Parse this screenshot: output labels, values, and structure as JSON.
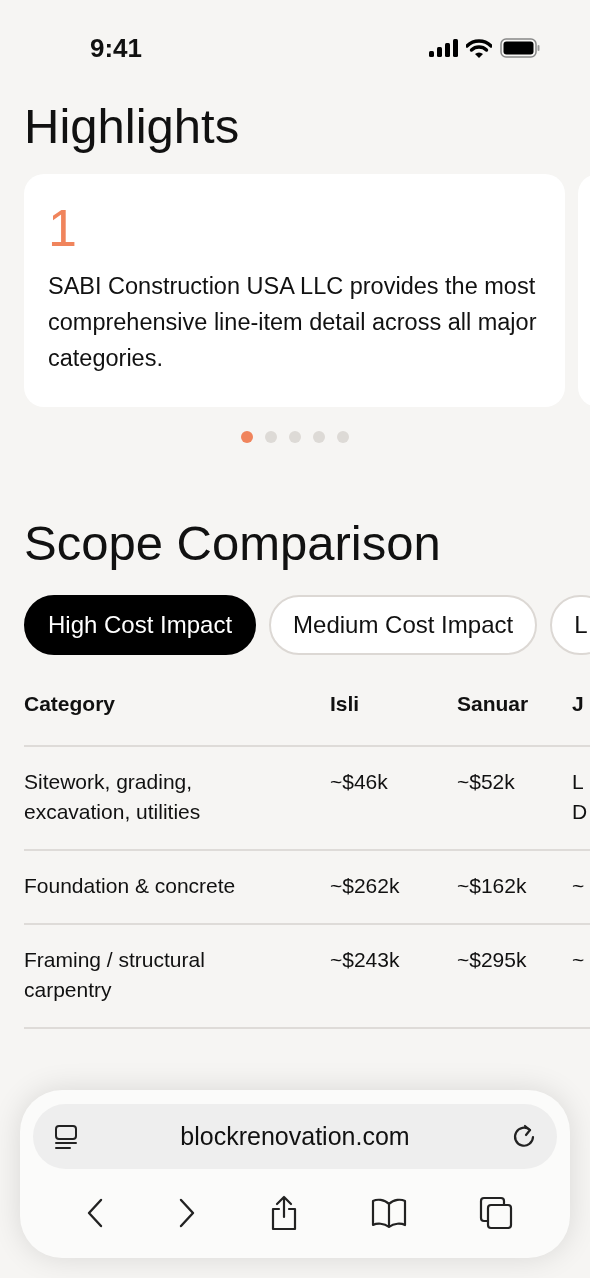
{
  "status_bar": {
    "time": "9:41"
  },
  "highlights": {
    "title": "Highlights",
    "cards": [
      {
        "number": "1",
        "text": "SABI Construction USA LLC provides the most comprehensive line-item detail across all major categories."
      }
    ],
    "pager": [
      {
        "selected": true
      },
      {
        "selected": false
      },
      {
        "selected": false
      },
      {
        "selected": false
      },
      {
        "selected": false
      }
    ]
  },
  "scope": {
    "title": "Scope Comparison",
    "filters": [
      {
        "label": "High Cost Impact",
        "selected": true
      },
      {
        "label": "Medium Cost Impact",
        "selected": false
      },
      {
        "label": "L",
        "selected": false
      }
    ],
    "table": {
      "columns": [
        "Category",
        "Isli",
        "Sanuar",
        "J"
      ],
      "rows": [
        [
          "Sitework, grading, excavation, utilities",
          "~$46k",
          "~$52k",
          "L D"
        ],
        [
          "Foundation & concrete",
          "~$262k",
          "~$162k",
          "~"
        ],
        [
          "Framing / structural carpentry",
          "~$243k",
          "~$295k",
          "~"
        ]
      ]
    }
  },
  "browser": {
    "url": "blockrenovation.com"
  }
}
